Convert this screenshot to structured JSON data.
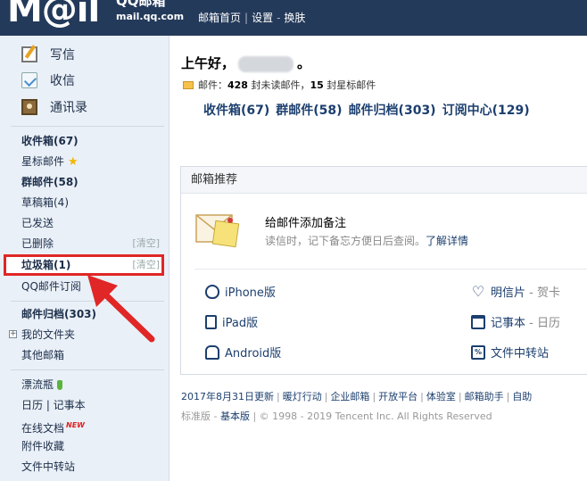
{
  "header": {
    "logo_text": "M@il",
    "brand": "QQ邮箱",
    "domain": "mail.qq.com",
    "nav": [
      "邮箱首页",
      "设置",
      "换肤"
    ]
  },
  "sidebar": {
    "quick_actions": [
      {
        "label": "写信",
        "icon": "pencil-icon"
      },
      {
        "label": "收信",
        "icon": "inbox-icon"
      },
      {
        "label": "通讯录",
        "icon": "contacts-icon"
      }
    ],
    "folders": [
      {
        "label": "收件箱(67)",
        "bold": true
      },
      {
        "label": "星标邮件",
        "bold": false,
        "icon": "star-icon"
      },
      {
        "label": "群邮件(58)",
        "bold": true
      },
      {
        "label": "草稿箱(4)",
        "bold": false
      },
      {
        "label": "已发送",
        "bold": false
      },
      {
        "label": "已删除",
        "bold": false,
        "action": "[清空]"
      },
      {
        "label": "垃圾箱(1)",
        "bold": true,
        "action": "[清空]",
        "highlighted": true
      },
      {
        "label": "QQ邮件订阅",
        "bold": false
      }
    ],
    "archive": [
      {
        "label": "邮件归档(303)",
        "bold": true
      },
      {
        "label": "我的文件夹",
        "bold": false,
        "expand": "+"
      },
      {
        "label": "其他邮箱",
        "bold": false
      }
    ],
    "tools": [
      {
        "label": "漂流瓶",
        "icon": "bottle-icon"
      },
      {
        "label": "日历 | 记事本"
      },
      {
        "label": "在线文档",
        "badge": "NEW"
      },
      {
        "label": "附件收藏"
      },
      {
        "label": "文件中转站"
      }
    ],
    "highlight_color": "#e02626"
  },
  "main": {
    "greeting": "上午好，",
    "greeting_end": "。",
    "mail_info_prefix": "邮件：",
    "unread_count": "428",
    "unread_suffix": " 封未读邮件，",
    "starred_count": "15",
    "starred_suffix": " 封星标邮件",
    "quick_links": [
      "收件箱(67)",
      "群邮件(58)",
      "邮件归档(303)",
      "订阅中心(129)"
    ]
  },
  "panel": {
    "title": "邮箱推荐",
    "rec_title": "给邮件添加备注",
    "rec_desc": "读信时，记下备忘方便日后查阅。",
    "rec_link": "了解详情",
    "apps": [
      {
        "label": "iPhone版",
        "icon": "apple-icon"
      },
      {
        "label": "明信片",
        "sub": " - 贺卡",
        "icon": "heart-icon"
      },
      {
        "label": "iPad版",
        "icon": "ipad-icon"
      },
      {
        "label": "记事本",
        "sub": " - 日历",
        "icon": "calendar-icon"
      },
      {
        "label": "Android版",
        "icon": "android-icon"
      },
      {
        "label": "文件中转站",
        "icon": "file-transfer-icon"
      }
    ]
  },
  "footer": {
    "links": [
      "2017年8月31日更新",
      "暖灯行动",
      "企业邮箱",
      "开放平台",
      "体验室",
      "邮箱助手",
      "自助"
    ],
    "edition_prefix": "标准版",
    "edition_link": "基本版",
    "copyright": "© 1998 - 2019 Tencent Inc. All Rights Reserved"
  }
}
